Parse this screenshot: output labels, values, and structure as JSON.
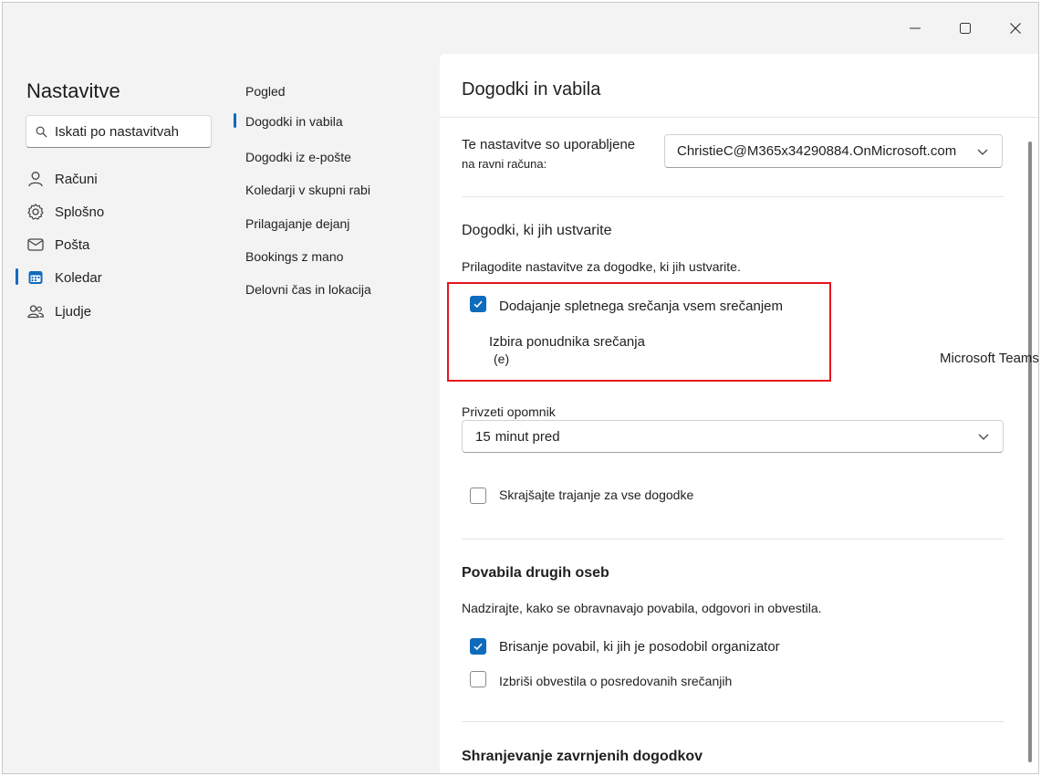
{
  "window": {
    "minimize_label": "Minimize",
    "maximize_label": "Maximize",
    "close_label": "Close"
  },
  "nav": {
    "title": "Nastavitve",
    "search_placeholder": "Iskati po nastavitvah",
    "items": [
      {
        "label": "Računi",
        "icon": "person-icon"
      },
      {
        "label": "Splošno",
        "icon": "gear-icon"
      },
      {
        "label": "Pošta",
        "icon": "mail-icon"
      },
      {
        "label": "Koledar",
        "icon": "calendar-icon",
        "active": true
      },
      {
        "label": "Ljudje",
        "icon": "people-icon"
      }
    ]
  },
  "subnav": {
    "items": [
      {
        "label": "Pogled"
      },
      {
        "label": "Dogodki in vabila",
        "active": true
      },
      {
        "label": "Dogodki iz e-pošte"
      },
      {
        "label": "Koledarji v skupni rabi"
      },
      {
        "label": "Prilagajanje dejanj"
      },
      {
        "label": "Bookings z mano"
      },
      {
        "label": "Delovni čas in lokacija"
      }
    ]
  },
  "pane": {
    "title": "Dogodki in vabila",
    "applied_line1": "Te nastavitve so uporabljene",
    "applied_line2": "na ravni računa:",
    "account_value": "ChristieC@M365x34290884.OnMicrosoft.com",
    "section_created": {
      "header": "Dogodki, ki jih ustvarite",
      "desc": "Prilagodite nastavitve za dogodke, ki jih ustvarite.",
      "add_online_label": "Dodajanje spletnega srečanja vsem srečanjem",
      "add_online_checked": true,
      "provider_label": "Izbira ponudnika srečanja",
      "provider_option": "(e)",
      "provider_value": "Microsoft Teams",
      "reminder_label": "Privzeti opomnik",
      "reminder_value": "15",
      "reminder_unit": "minut pred",
      "shorten_label": "Skrajšajte trajanje za vse dogodke",
      "shorten_checked": false
    },
    "section_others": {
      "header": "Povabila drugih oseb",
      "desc": "Nadzirajte, kako se obravnavajo povabila, odgovori in obvestila.",
      "delete_updated_label": "Brisanje povabil, ki jih je posodobil organizator",
      "delete_updated_checked": true,
      "delete_forwarded_label": "Izbriši obvestila o posredovanih srečanjih",
      "delete_forwarded_checked": false
    },
    "section_saving": {
      "header": "Shranjevanje zavrnjenih dogodkov"
    }
  },
  "colors": {
    "accent": "#0f6cbd",
    "highlight_box": "#e4161c",
    "background": "#f3f3f3"
  }
}
